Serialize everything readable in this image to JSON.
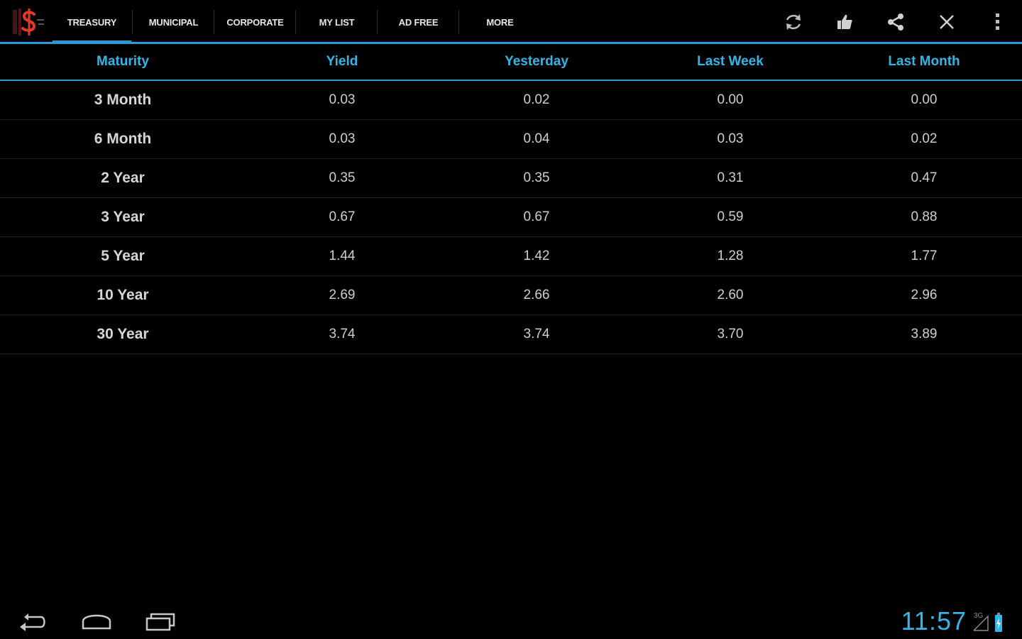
{
  "tabs": [
    {
      "label": "TREASURY",
      "active": true
    },
    {
      "label": "MUNICIPAL",
      "active": false
    },
    {
      "label": "CORPORATE",
      "active": false
    },
    {
      "label": "MY LIST",
      "active": false
    },
    {
      "label": "AD FREE",
      "active": false
    },
    {
      "label": "MORE",
      "active": false
    }
  ],
  "actions": [
    "refresh-icon",
    "thumbs-up-icon",
    "share-icon",
    "close-icon",
    "overflow-menu-icon"
  ],
  "table": {
    "headers": [
      "Maturity",
      "Yield",
      "Yesterday",
      "Last Week",
      "Last Month"
    ],
    "rows": [
      {
        "maturity": "3 Month",
        "yield": "0.03",
        "yesterday": "0.02",
        "last_week": "0.00",
        "last_month": "0.00"
      },
      {
        "maturity": "6 Month",
        "yield": "0.03",
        "yesterday": "0.04",
        "last_week": "0.03",
        "last_month": "0.02"
      },
      {
        "maturity": "2 Year",
        "yield": "0.35",
        "yesterday": "0.35",
        "last_week": "0.31",
        "last_month": "0.47"
      },
      {
        "maturity": "3 Year",
        "yield": "0.67",
        "yesterday": "0.67",
        "last_week": "0.59",
        "last_month": "0.88"
      },
      {
        "maturity": "5 Year",
        "yield": "1.44",
        "yesterday": "1.42",
        "last_week": "1.28",
        "last_month": "1.77"
      },
      {
        "maturity": "10 Year",
        "yield": "2.69",
        "yesterday": "2.66",
        "last_week": "2.60",
        "last_month": "2.96"
      },
      {
        "maturity": "30 Year",
        "yield": "3.74",
        "yesterday": "3.74",
        "last_week": "3.70",
        "last_month": "3.89"
      }
    ]
  },
  "status_bar": {
    "clock": "11:57",
    "signal_label": "3G"
  },
  "colors": {
    "accent": "#33b5e5",
    "tab_indicator": "#2b9ad0",
    "background": "#000000"
  }
}
